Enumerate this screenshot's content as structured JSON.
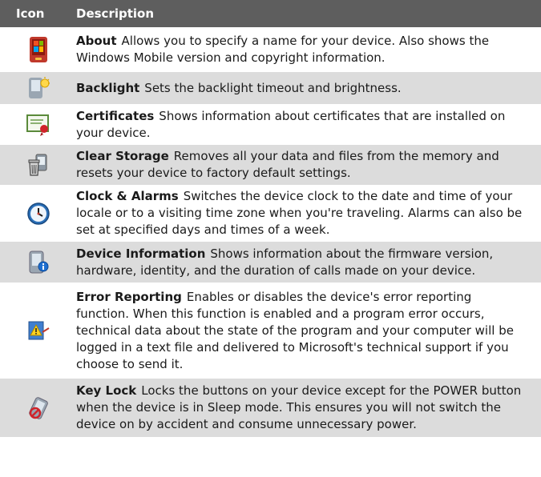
{
  "header": {
    "icon": "Icon",
    "description": "Description"
  },
  "rows": [
    {
      "icon": "about-icon",
      "name": "About",
      "text": "Allows you to specify a name for your device. Also shows the Windows Mobile version and copyright information."
    },
    {
      "icon": "backlight-icon",
      "name": "Backlight",
      "text": "Sets the backlight timeout and brightness."
    },
    {
      "icon": "certificates-icon",
      "name": "Certificates",
      "text": "Shows information about certificates that are installed on your device."
    },
    {
      "icon": "clear-storage-icon",
      "name": "Clear Storage",
      "text": "Removes all your data and files from the memory and resets your device to factory default settings."
    },
    {
      "icon": "clock-icon",
      "name": "Clock & Alarms",
      "text": "Switches the device clock to the date and time of your locale or to a visiting time zone when you're traveling. Alarms can also be set at specified days and times of a week."
    },
    {
      "icon": "device-information-icon",
      "name": "Device Information",
      "text": "Shows information about the firmware version, hardware, identity, and the duration of calls made on your device."
    },
    {
      "icon": "error-reporting-icon",
      "name": "Error Reporting",
      "text": "Enables or disables the device's error reporting function. When this function is enabled and a program error occurs, technical data about the state of the program and your computer will be logged in a text file and delivered to Microsoft's technical support if you choose to send it."
    },
    {
      "icon": "key-lock-icon",
      "name": "Key Lock",
      "text": "Locks the buttons on your device except for the POWER button when the device is in Sleep mode. This ensures you will not switch the device on by accident and consume unnecessary power."
    }
  ]
}
